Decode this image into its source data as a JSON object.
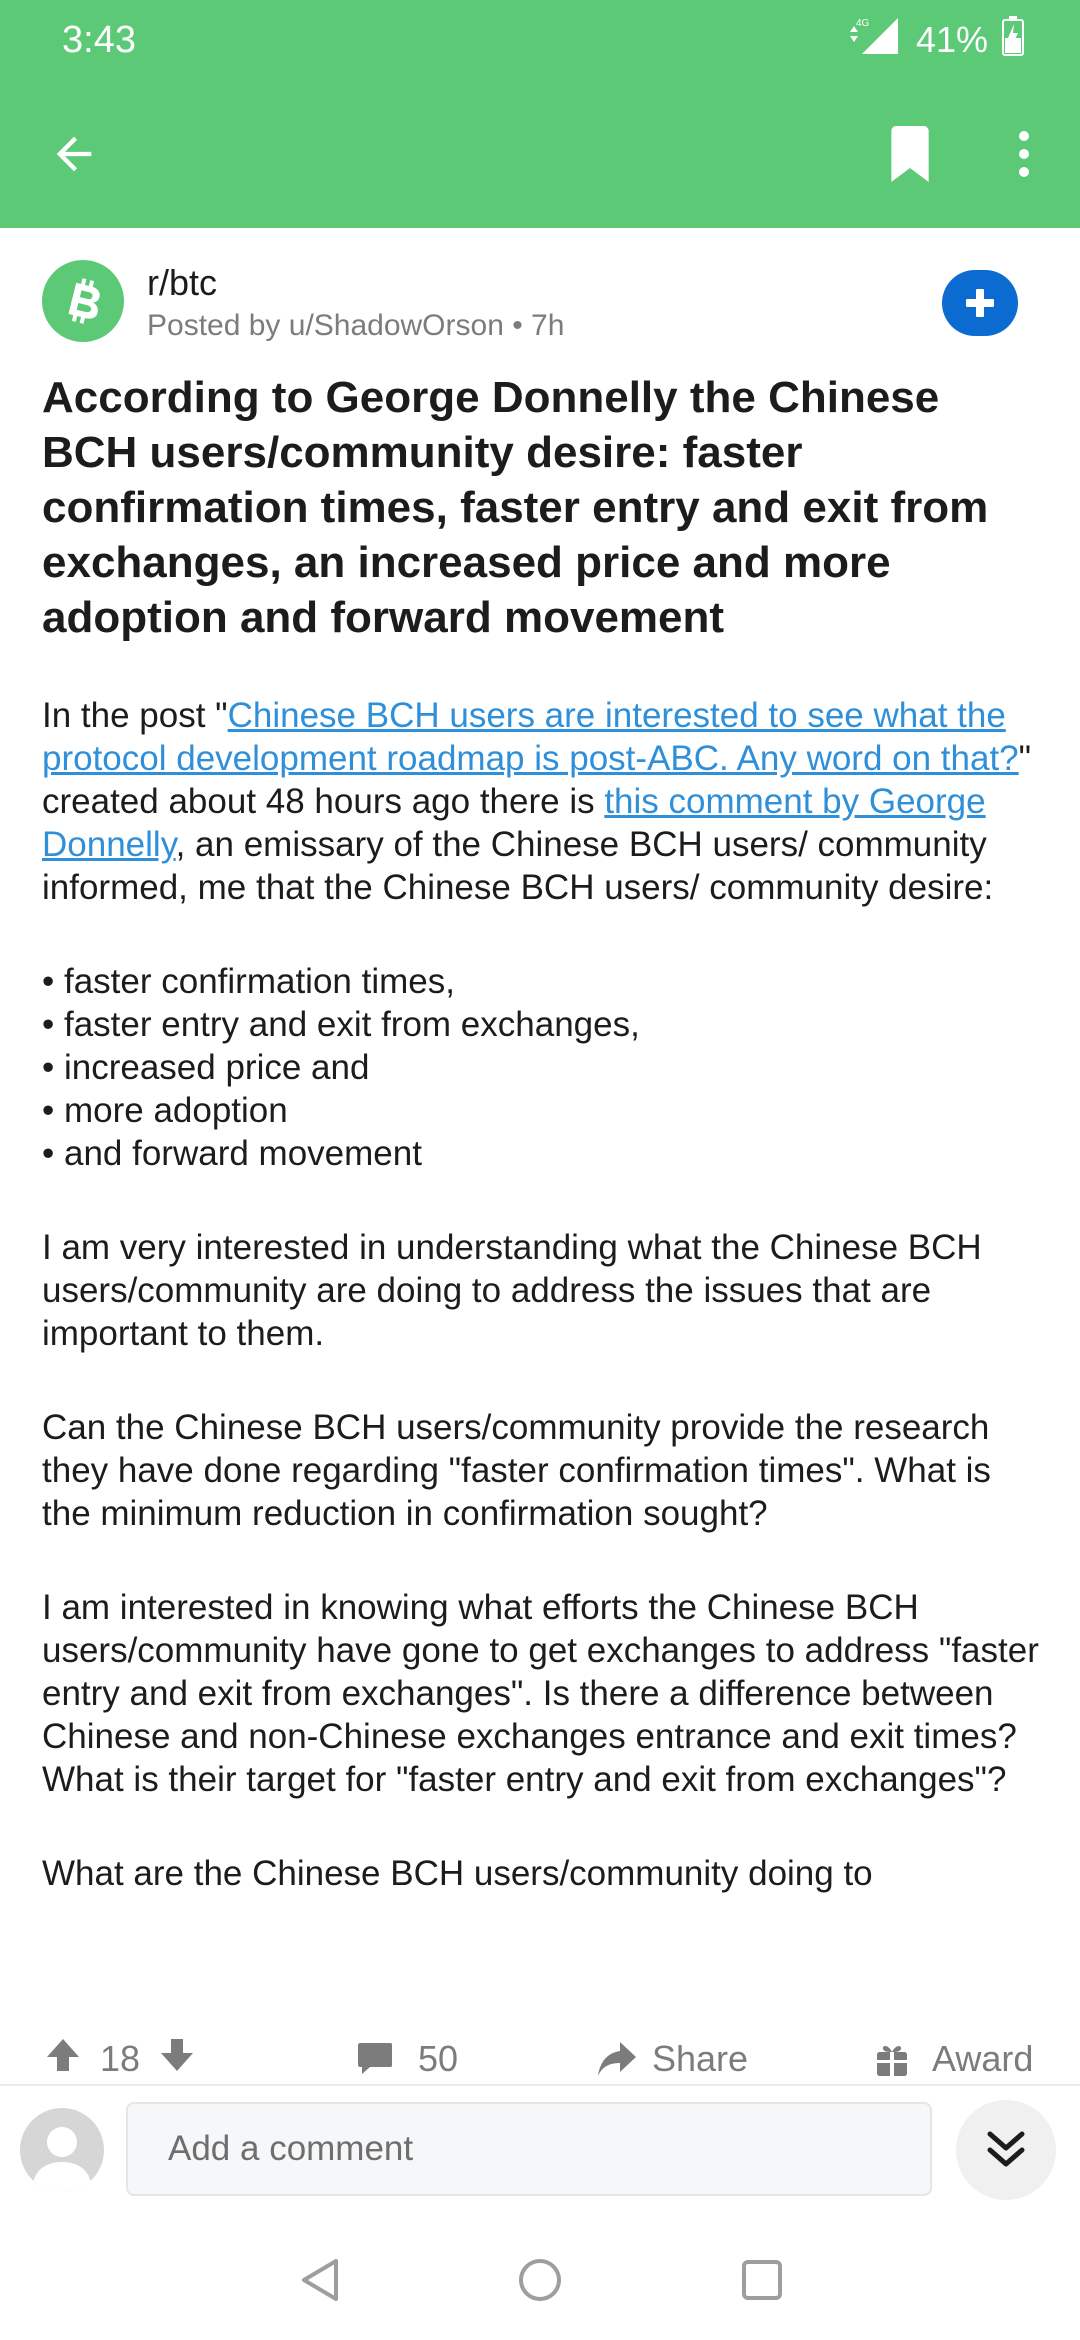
{
  "status_bar": {
    "time": "3:43",
    "network": "4G",
    "battery": "41%"
  },
  "toolbar": {
    "back_icon": "arrow-left-icon",
    "bookmark_icon": "bookmark-icon",
    "more_icon": "more-vertical-icon"
  },
  "post": {
    "subreddit": "r/btc",
    "posted_by": "Posted by u/ShadowOrson • 7h",
    "title": "According to George Donnelly the Chinese BCH users/community desire: faster confirmation times, faster entry and exit from exchanges, an increased price and more adoption and forward movement",
    "intro_prefix": "In the post \"",
    "intro_link1": "Chinese BCH users are interested to see what the protocol development roadmap is post-ABC. Any word on that?",
    "intro_mid": "\" created about 48 hours ago there is ",
    "intro_link2": "this comment by George Donnelly",
    "intro_suffix": ", an emissary of the Chinese BCH users/ community informed, me that the Chinese BCH users/ community desire:",
    "bullets": [
      "faster confirmation times,",
      "faster entry and exit from exchanges,",
      "increased price and",
      "more adoption",
      "and forward movement"
    ],
    "paragraphs": [
      "I am very interested in understanding what the Chinese BCH users/community are doing to address the issues that are important to them.",
      "Can the Chinese BCH users/community provide the research they have done regarding \"faster confirmation times\". What is the minimum reduction in confirmation sought?",
      "I am interested in knowing what efforts the Chinese BCH users/community have gone to get exchanges to address \"faster entry and exit from exchanges\". Is there a difference between Chinese and non-Chinese exchanges entrance and exit times? What is their target for \"faster entry and exit from exchanges\"?",
      "What are the Chinese BCH users/community doing to"
    ]
  },
  "actions": {
    "votes": "18",
    "comments": "50",
    "share": "Share",
    "award": "Award"
  },
  "comment_bar": {
    "placeholder": "Add a comment"
  },
  "colors": {
    "header": "#5cc977",
    "accent_blue": "#0b6bd0",
    "link": "#2f8fd8"
  }
}
